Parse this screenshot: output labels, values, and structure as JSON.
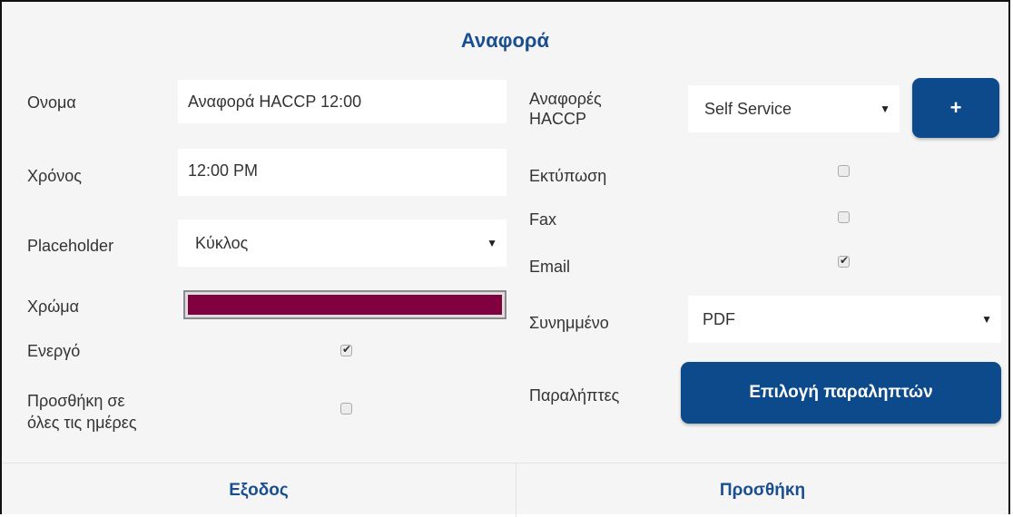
{
  "dialog": {
    "title": "Αναφορά"
  },
  "left": {
    "name_label": "Ονομα",
    "name_value": "Αναφορά HACCP 12:00",
    "time_label": "Χρόνος",
    "time_value": "12:00 PM",
    "placeholder_label": "Placeholder",
    "placeholder_value": "Κύκλος",
    "color_label": "Χρώμα",
    "color_value": "#800040",
    "active_label": "Ενεργό",
    "active_checked": true,
    "all_days_label_line1": "Προσθήκη σε",
    "all_days_label_line2": "όλες τις ημέρες",
    "all_days_checked": false
  },
  "right": {
    "haccp_label_line1": "Αναφορές",
    "haccp_label_line2": "HACCP",
    "haccp_value": "Self Service",
    "add_button": "+",
    "print_label": "Εκτύπωση",
    "print_checked": false,
    "fax_label": "Fax",
    "fax_checked": false,
    "email_label": "Email",
    "email_checked": true,
    "attachment_label": "Συνημμένο",
    "attachment_value": "PDF",
    "recipients_label": "Παραλήπτες",
    "recipients_button": "Επιλογή παραληπτών"
  },
  "footer": {
    "exit": "Εξοδος",
    "add": "Προσθήκη"
  },
  "icons": {
    "dropdown": "caret-down-icon",
    "check": "checkmark-icon"
  },
  "colors": {
    "accent": "#0d4a8b",
    "title": "#1a4f8f",
    "background": "#f5f5f5"
  }
}
